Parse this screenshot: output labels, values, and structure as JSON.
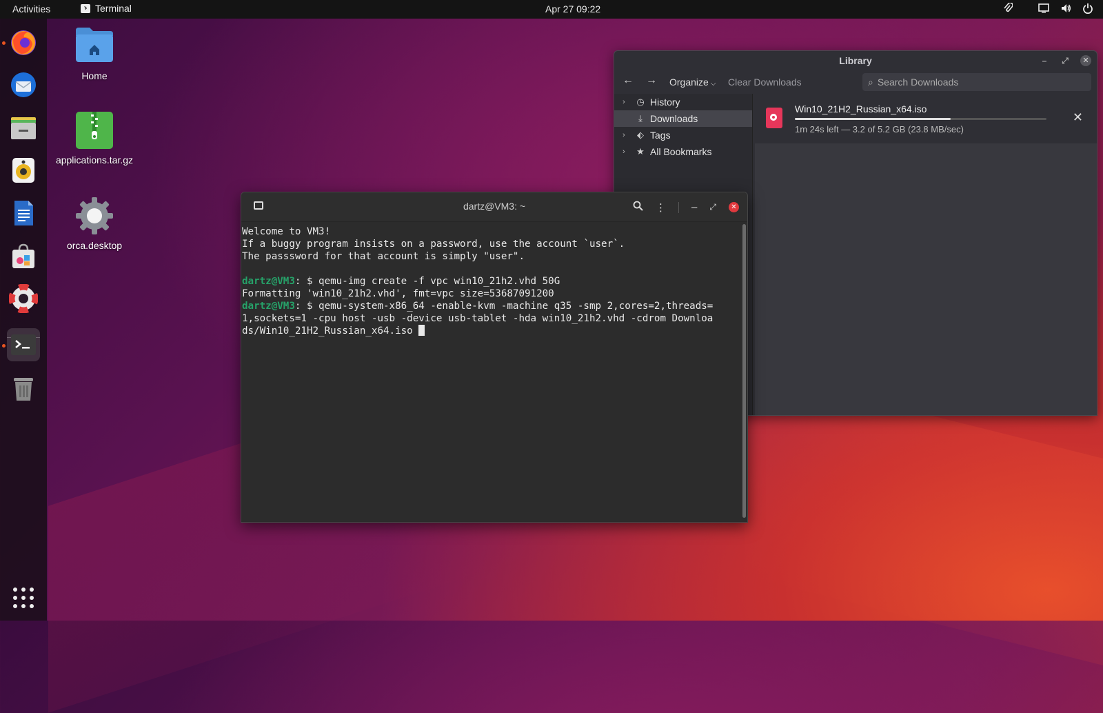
{
  "topbar": {
    "activities": "Activities",
    "app_name": "Terminal",
    "clock": "Apr 27  09:22"
  },
  "desktop": {
    "icons": [
      {
        "label": "Home"
      },
      {
        "label": "applications.tar.gz"
      },
      {
        "label": "orca.desktop"
      }
    ]
  },
  "library": {
    "title": "Library",
    "organize": "Organize",
    "clear_downloads": "Clear Downloads",
    "search_placeholder": "Search Downloads",
    "sidebar": [
      {
        "label": "History"
      },
      {
        "label": "Downloads"
      },
      {
        "label": "Tags"
      },
      {
        "label": "All Bookmarks"
      }
    ],
    "download": {
      "filename": "Win10_21H2_Russian_x64.iso",
      "status": "1m 24s left — 3.2 of 5.2 GB (23.8 MB/sec)",
      "progress": 0.62
    }
  },
  "terminal": {
    "title": "dartz@VM3: ~",
    "line1": "Welcome to VM3!",
    "line2": "If a buggy program insists on a password, use the account `user`.",
    "line3": "The passsword for that account is simply \"user\".",
    "prompt": "dartz@VM3",
    "cmd1": ": $ qemu-img create -f vpc win10_21h2.vhd 50G",
    "out1": "Formatting 'win10_21h2.vhd', fmt=vpc size=53687091200",
    "cmd2_a": ": $ qemu-system-x86_64 -enable-kvm -machine q35 -smp 2,cores=2,threads=",
    "cmd2_b": "1,sockets=1 -cpu host -usb -device usb-tablet -hda win10_21h2.vhd -cdrom Downloa",
    "cmd2_c": "ds/Win10_21H2_Russian_x64.iso "
  }
}
